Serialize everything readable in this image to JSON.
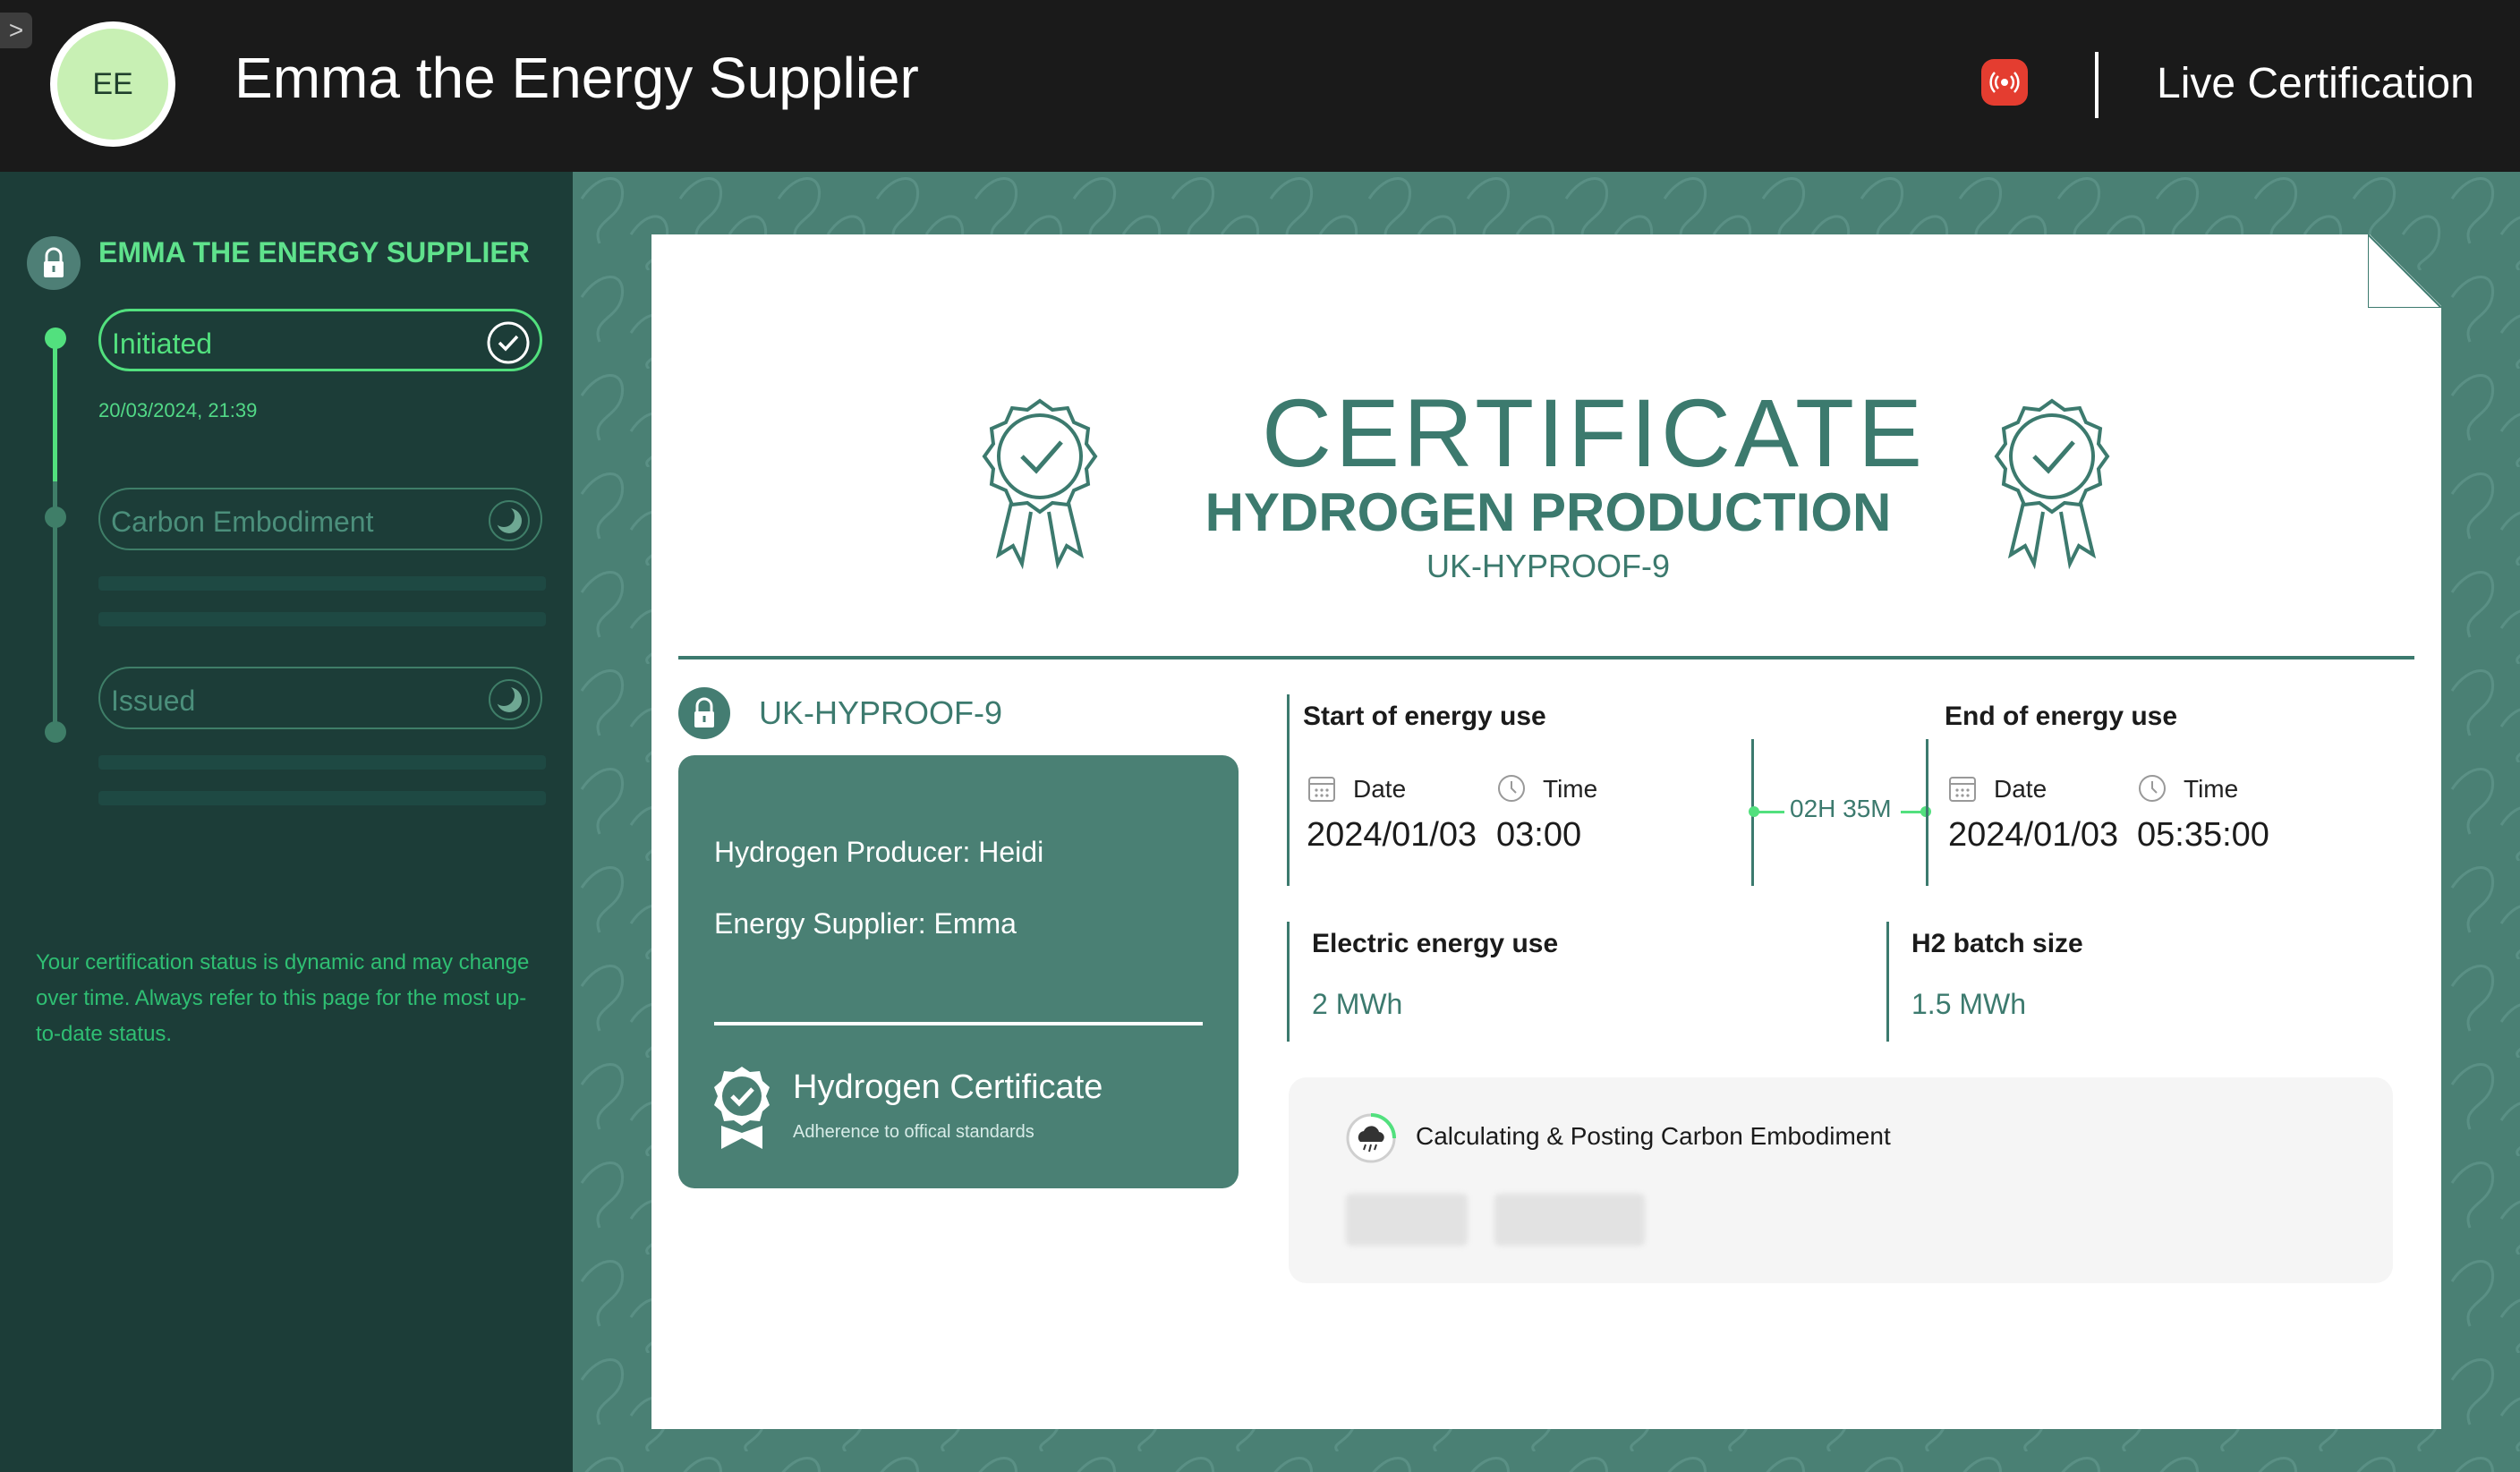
{
  "header": {
    "expand_glyph": ">",
    "avatar_initials": "EE",
    "title": "Emma the Energy Supplier",
    "live_label": "Live Certification",
    "live_icon": "broadcast-icon",
    "live_icon_color": "#e43d30"
  },
  "sidebar": {
    "title": "EMMA THE ENERGY SUPPLIER",
    "steps": [
      {
        "label": "Initiated",
        "status": "complete",
        "date": "20/03/2024, 21:39"
      },
      {
        "label": "Carbon Embodiment",
        "status": "pending"
      },
      {
        "label": "Issued",
        "status": "pending"
      }
    ],
    "note": "Your certification status is dynamic and may change over time. Always refer to this page for the most up-to-date status."
  },
  "certificate": {
    "title": "CERTIFICATE",
    "subtitle": "HYDROGEN PRODUCTION",
    "code": "UK-HYPROOF-9",
    "id_label": "UK-HYPROOF-9",
    "producer": "Hydrogen Producer: Heidi",
    "supplier": "Energy Supplier: Emma",
    "badge_title": "Hydrogen Certificate",
    "badge_subtitle": "Adherence to offical standards",
    "start": {
      "title": "Start of energy use",
      "date_label": "Date",
      "time_label": "Time",
      "date": "2024/01/03",
      "time": "03:00"
    },
    "end": {
      "title": "End of energy use",
      "date_label": "Date",
      "time_label": "Time",
      "date": "2024/01/03",
      "time": "05:35:00"
    },
    "duration": "02H 35M",
    "electric": {
      "label": "Electric energy use",
      "value": "2 MWh"
    },
    "batch": {
      "label": "H2 batch size",
      "value": "1.5 MWh"
    },
    "carbon_status": "Calculating & Posting Carbon Embodiment"
  },
  "colors": {
    "accent_green": "#52e07e",
    "teal": "#3c7a6e",
    "sidebar_bg": "#1c3d38",
    "main_bg": "#4a8074"
  }
}
